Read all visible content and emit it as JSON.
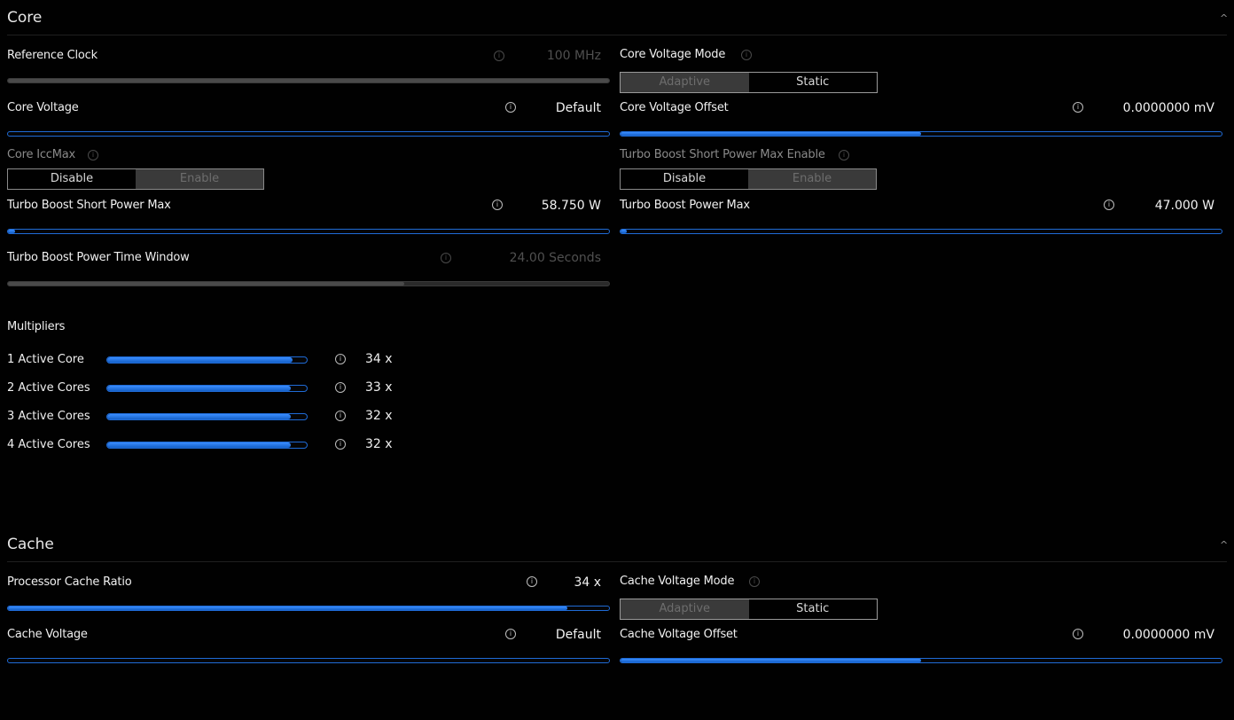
{
  "core": {
    "title": "Core",
    "chevron": "^",
    "reference_clock": {
      "label": "Reference Clock",
      "value": "100 MHz",
      "fill": 1.0
    },
    "core_voltage_mode": {
      "label": "Core Voltage Mode",
      "options": [
        "Adaptive",
        "Static"
      ],
      "selected": "Adaptive"
    },
    "core_voltage": {
      "label": "Core Voltage",
      "value": "Default",
      "fill": 0
    },
    "core_voltage_offset": {
      "label": "Core Voltage Offset",
      "value": "0.0000000 mV",
      "fill": 0.5
    },
    "core_iccmax": {
      "label": "Core IccMax",
      "options": [
        "Disable",
        "Enable"
      ],
      "selected": "Enable"
    },
    "turbo_short_enable": {
      "label": "Turbo Boost Short Power Max Enable",
      "options": [
        "Disable",
        "Enable"
      ],
      "selected": "Enable"
    },
    "turbo_short_power_max": {
      "label": "Turbo Boost Short Power Max",
      "value": "58.750 W",
      "fill": 0.012
    },
    "turbo_power_max": {
      "label": "Turbo Boost Power Max",
      "value": "47.000 W",
      "fill": 0.01
    },
    "turbo_time_window": {
      "label": "Turbo Boost Power Time Window",
      "value": "24.00 Seconds",
      "fill": 0.66
    },
    "multipliers": {
      "title": "Multipliers",
      "items": [
        {
          "label": "1 Active Core",
          "value": "34 x",
          "fill": 0.93
        },
        {
          "label": "2 Active Cores",
          "value": "33 x",
          "fill": 0.92
        },
        {
          "label": "3 Active Cores",
          "value": "32 x",
          "fill": 0.92
        },
        {
          "label": "4 Active Cores",
          "value": "32 x",
          "fill": 0.92
        }
      ]
    }
  },
  "cache": {
    "title": "Cache",
    "chevron": "^",
    "processor_cache_ratio": {
      "label": "Processor Cache Ratio",
      "value": "34 x",
      "fill": 0.93
    },
    "cache_voltage_mode": {
      "label": "Cache Voltage Mode",
      "options": [
        "Adaptive",
        "Static"
      ],
      "selected": "Adaptive"
    },
    "cache_voltage": {
      "label": "Cache Voltage",
      "value": "Default",
      "fill": 0
    },
    "cache_voltage_offset": {
      "label": "Cache Voltage Offset",
      "value": "0.0000000 mV",
      "fill": 0.5
    }
  },
  "icons": {
    "info": "info-icon",
    "collapse": "chevron-up-icon"
  },
  "colors": {
    "accent": "#1f6bd6",
    "background": "#010101",
    "disabled": "#3a3a3a"
  }
}
